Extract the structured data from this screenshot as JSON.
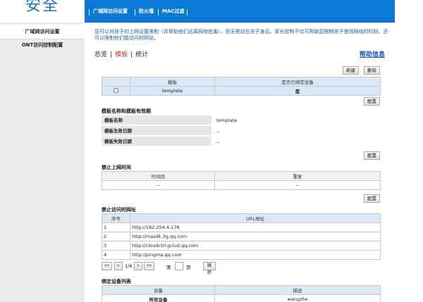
{
  "brand": {
    "text": "安全",
    "color": "#1f6fc4"
  },
  "nav": {
    "items": [
      {
        "label": "广域网访问设置"
      },
      {
        "label": "防火墙"
      },
      {
        "label": "MAC过滤"
      }
    ],
    "color": "#0a7ad6"
  },
  "sidebar": {
    "items": [
      {
        "label": "广域网访问设置"
      },
      {
        "label": "ONT访问控制配置"
      }
    ]
  },
  "description": "您可以对孩子的上网设置限制（并帮助他们远离网络危害），而无需站在孩子身后。家长控制不仅可帮助您限制孩子使用网络的时刻，还可以限制他们能访问的网站。",
  "tabs": {
    "items": [
      {
        "label": "总览"
      },
      {
        "label": "模板"
      },
      {
        "label": "统计"
      }
    ],
    "active_color": "#d0342c"
  },
  "help_link": "帮助信息",
  "buttons": {
    "new": "新建",
    "delete": "删除",
    "configure": "配置",
    "goto": "跳转"
  },
  "template_table": {
    "headers": [
      "",
      "模板",
      "是否已绑定设备"
    ],
    "rows": [
      {
        "name": "template",
        "bound": "是"
      }
    ]
  },
  "validity": {
    "title": "模板名称和模板有效期",
    "rows": [
      {
        "label": "模板名称",
        "value": "template"
      },
      {
        "label": "模板生效日期",
        "value": "--"
      },
      {
        "label": "模板失效日期",
        "value": "--"
      }
    ]
  },
  "time_block": {
    "title": "禁止上网时间",
    "headers": [
      "时间段",
      "重复"
    ],
    "row": [
      "--",
      "--"
    ]
  },
  "url_block": {
    "title": "禁止访问的网址",
    "headers": [
      "序号",
      "URL地址"
    ],
    "rows": [
      {
        "no": "1",
        "url": "http://182.254.4.176"
      },
      {
        "no": "2",
        "url": "http://masdk.3g.qq.com"
      },
      {
        "no": "3",
        "url": "http://cloudctrl.gclud.qq.com"
      },
      {
        "no": "4",
        "url": "http://pingma.qq.com"
      }
    ]
  },
  "pager": {
    "first": "<<",
    "prev": "<",
    "page": "1/6",
    "next": ">",
    "last": ">>",
    "go_prefix": "第",
    "go_suffix": "页"
  },
  "device_block": {
    "title": "绑定设备列表",
    "headers": [
      "设备",
      "描述"
    ],
    "rows": [
      {
        "device": "所有设备",
        "desc": "wangzhe"
      }
    ]
  }
}
